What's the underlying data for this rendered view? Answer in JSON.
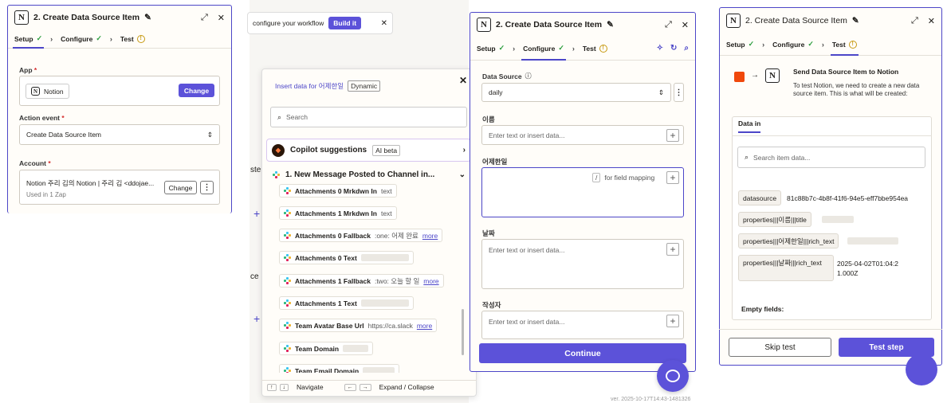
{
  "panel_left": {
    "title": "2. Create Data Source Item",
    "tabs": [
      "Setup",
      "Configure",
      "Test"
    ],
    "app_label": "App",
    "app_value": "Notion",
    "change_label": "Change",
    "event_label": "Action event",
    "event_value": "Create Data Source Item",
    "account_label": "Account",
    "account_value": "Notion 주리 김의 Notion | 주리 김 <ddojae...",
    "account_sub": "Used in 1 Zap",
    "account_change": "Change"
  },
  "banner": {
    "text": "configure your workflow",
    "button": "Build it"
  },
  "insert_popup": {
    "title": "Insert data for 어제한일",
    "badge": "Dynamic",
    "search_placeholder": "Search",
    "copilot": "Copilot suggestions",
    "copilot_badge": "AI beta",
    "step": "1.  New Message Posted to Channel in...",
    "items": [
      {
        "label": "Attachments 0 Mrkdwn In",
        "value": "text",
        "more": ""
      },
      {
        "label": "Attachments 1 Mrkdwn In",
        "value": "text",
        "more": ""
      },
      {
        "label": "Attachments 0 Fallback",
        "value": ":one: 어제 완료",
        "more": "more"
      },
      {
        "label": "Attachments 0 Text",
        "value": "",
        "more": ""
      },
      {
        "label": "Attachments 1 Fallback",
        "value": ":two: 오늘 할 일",
        "more": "more"
      },
      {
        "label": "Attachments 1 Text",
        "value": "",
        "more": ""
      },
      {
        "label": "Team Avatar Base Url",
        "value": "https://ca.slack",
        "more": "more"
      },
      {
        "label": "Team Domain",
        "value": "",
        "more": ""
      },
      {
        "label": "Team Email Domain",
        "value": "",
        "more": ""
      }
    ],
    "footer_navigate": "Navigate",
    "footer_expand": "Expand / Collapse"
  },
  "bg_fragments": {
    "a": "ste",
    "b": "ce",
    "version": "ver. 2025-10-17T14:43-1481326"
  },
  "panel_mid": {
    "title": "2. Create Data Source Item",
    "tabs": [
      "Setup",
      "Configure",
      "Test"
    ],
    "ds_label": "Data Source",
    "ds_value": "daily",
    "f1_label": "이름",
    "f1_placeholder": "Enter text or insert data...",
    "f2_label": "어제한일",
    "f2_hint_key": "/",
    "f2_hint": "for field mapping",
    "f3_label": "날짜",
    "f3_placeholder": "Enter text or insert data...",
    "f4_label": "작성자",
    "f4_placeholder": "Enter text or insert data...",
    "continue": "Continue"
  },
  "panel_right": {
    "title": "2. Create Data Source Item",
    "tabs": [
      "Setup",
      "Configure",
      "Test"
    ],
    "send_title": "Send Data Source Item to Notion",
    "send_desc": "To test Notion, we need to create a new data source item. This is what will be created:",
    "data_in": "Data in",
    "search_placeholder": "Search item data...",
    "rows": [
      {
        "key": "datasource",
        "value": "81c88b7c-4b8f-41f6-94e5-eff7bbe954ea"
      },
      {
        "key": "properties|||이름|||title",
        "value": ""
      },
      {
        "key": "properties|||어제한일|||rich_text",
        "value": ""
      },
      {
        "key": "properties|||날짜|||rich_text",
        "value": "2025-04-02T01:04:21.000Z"
      }
    ],
    "empty_fields": "Empty fields:",
    "skip": "Skip test",
    "test": "Test step"
  },
  "colors": {
    "accent": "#5c52d9",
    "border": "#4c46c8",
    "notion_orange": "#f0480c"
  }
}
